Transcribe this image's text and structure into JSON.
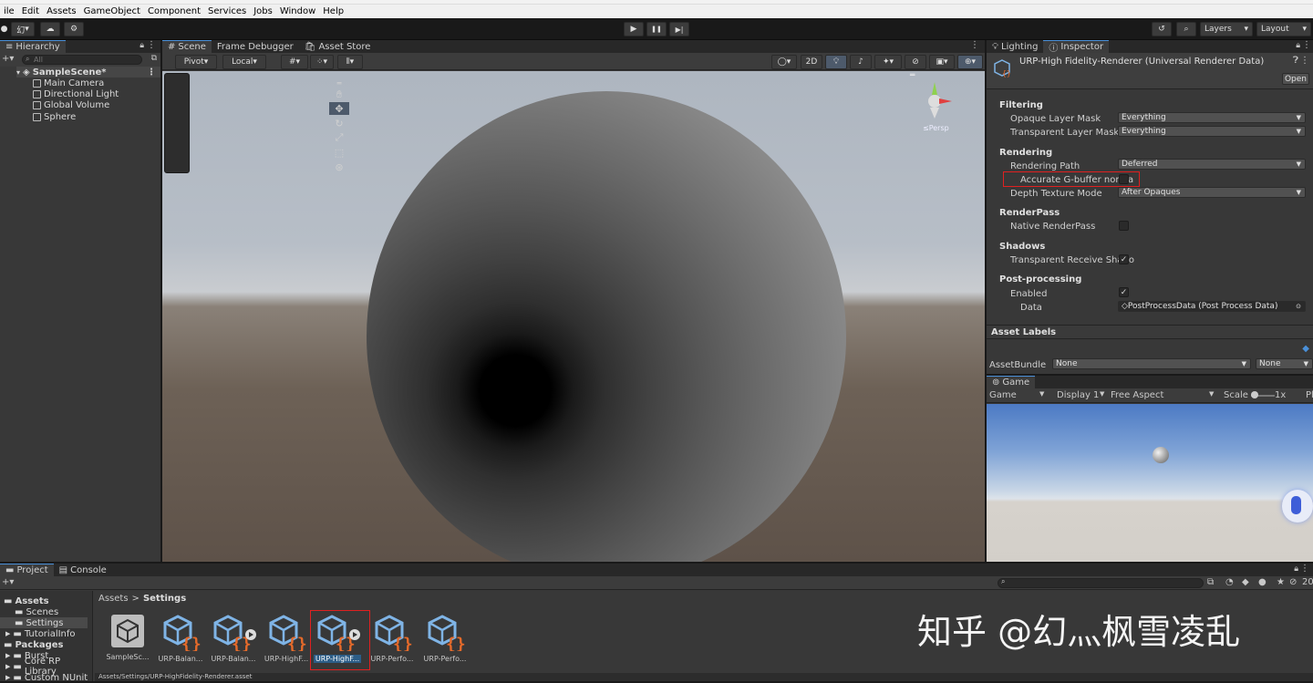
{
  "menu": [
    "ile",
    "Edit",
    "Assets",
    "GameObject",
    "Component",
    "Services",
    "Jobs",
    "Window",
    "Help"
  ],
  "toolbar": {
    "account": "幻",
    "play": "▶",
    "pause": "❚❚",
    "step": "▶|",
    "layers": "Layers",
    "layout": "Layout"
  },
  "hierarchy": {
    "tab": "Hierarchy",
    "search_placeholder": "All",
    "scene": "SampleScene*",
    "items": [
      "Main Camera",
      "Directional Light",
      "Global Volume",
      "Sphere"
    ]
  },
  "scene_tabs": [
    "Scene",
    "Frame Debugger",
    "Asset Store"
  ],
  "scene_toolbar": {
    "pivot": "Pivot",
    "local": "Local",
    "mode_2d": "2D",
    "persp": "≤Persp"
  },
  "inspector": {
    "tabs": [
      "Lighting",
      "Inspector"
    ],
    "title": "URP-High Fidelity-Renderer (Universal Renderer Data)",
    "open_button": "Open",
    "sections": {
      "filtering": "Filtering",
      "rendering": "Rendering",
      "renderpass": "RenderPass",
      "shadows": "Shadows",
      "postprocessing": "Post-processing"
    },
    "fields": {
      "opaque_label": "Opaque Layer Mask",
      "opaque_value": "Everything",
      "transparent_label": "Transparent Layer Mask",
      "transparent_value": "Everything",
      "path_label": "Rendering Path",
      "path_value": "Deferred",
      "gbuffer_label": "Accurate G-buffer norma",
      "depth_label": "Depth Texture Mode",
      "depth_value": "After Opaques",
      "native_label": "Native RenderPass",
      "shadow_label": "Transparent Receive Shado",
      "enabled_label": "Enabled",
      "data_label": "Data",
      "data_value": "PostProcessData (Post Process Data)"
    },
    "asset_labels": "Asset Labels",
    "assetbundle_label": "AssetBundle",
    "assetbundle_value": "None",
    "variant_value": "None"
  },
  "game": {
    "tab": "Game",
    "mode": "Game",
    "display": "Display 1",
    "aspect": "Free Aspect",
    "scale_label": "Scale",
    "scale_value": "1x",
    "extra": "Pl"
  },
  "project": {
    "tabs": [
      "Project",
      "Console"
    ],
    "tree": [
      {
        "label": "Assets",
        "bold": true
      },
      {
        "label": "Scenes",
        "bold": false
      },
      {
        "label": "Settings",
        "bold": false
      },
      {
        "label": "TutorialInfo",
        "bold": false
      },
      {
        "label": "Packages",
        "bold": true
      },
      {
        "label": "Burst",
        "bold": false
      },
      {
        "label": "Core RP Library",
        "bold": false
      },
      {
        "label": "Custom NUnit",
        "bold": false
      }
    ],
    "breadcrumb_root": "Assets",
    "breadcrumb_sep": ">",
    "breadcrumb_current": "Settings",
    "count": "20",
    "assets": [
      "SampleSc...",
      "URP-Balan...",
      "URP-Balan...",
      "URP-HighF...",
      "URP-HighF...",
      "URP-Perfo...",
      "URP-Perfo..."
    ],
    "status_path": "Assets/Settings/URP-HighFidelity-Renderer.asset"
  },
  "watermark": "知乎 @幻灬枫雪凌乱",
  "colors": {
    "accent": "#4a90d9",
    "highlight_box": "#e02020",
    "sky_top": "#aeb9c6",
    "ground": "#6b5f54"
  }
}
